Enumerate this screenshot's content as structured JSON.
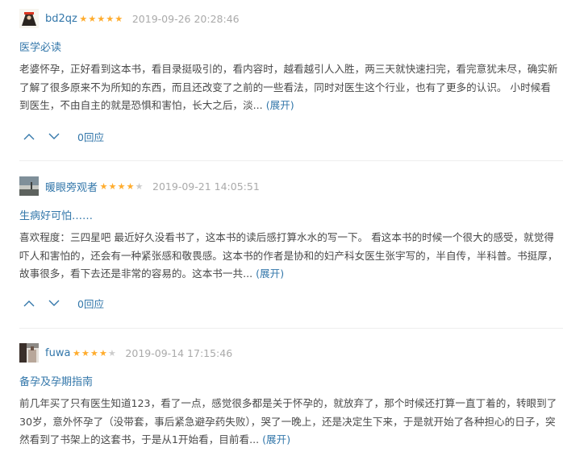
{
  "reviews": [
    {
      "avatar": "avatar-photo",
      "user": "bd2qz",
      "rating": 5,
      "date": "2019-09-26 20:28:46",
      "title": "医学必读",
      "text": "老婆怀孕，正好看到这本书，看目录挺吸引的，看内容时，越看越引人入胜，两三天就快速扫完，看完意犹未尽，确实新了解了很多原来不为所知的东西，而且还改变了之前的一些看法，同时对医生这个行业，也有了更多的认识。 小时候看到医生，不由自主的就是恐惧和害怕，长大之后，淡...",
      "expand": "(展开)",
      "replies": "0回应"
    },
    {
      "avatar": "avatar-photo",
      "user": "暖眼旁观者",
      "rating": 4,
      "date": "2019-09-21 14:05:51",
      "title": "生病好可怕……",
      "text": "喜欢程度：三四星吧 最近好久没看书了，这本书的读后感打算水水的写一下。 看这本书的时候一个很大的感受，就觉得吓人和害怕的，还会有一种紧张感和敬畏感。这本书的作者是协和的妇产科女医生张宇写的，半自传，半科普。书挺厚，故事很多，看下去还是非常的容易的。这本书一共...",
      "expand": "(展开)",
      "replies": "0回应"
    },
    {
      "avatar": "avatar-photo",
      "user": "fuwa",
      "rating": 4,
      "date": "2019-09-14 17:15:46",
      "title": "备孕及孕期指南",
      "text": "前几年买了只有医生知道123，看了一点，感觉很多都是关于怀孕的，就放弃了，那个时候还打算一直丁着的，转眼到了30岁，意外怀孕了（没带套，事后紧急避孕药失败），哭了一晚上，还是决定生下来，于是就开始了各种担心的日子，突然看到了书架上的这套书，于是从1开始看，目前看...",
      "expand": "(展开)",
      "replies": "0回应"
    }
  ],
  "colors": {
    "link": "#3377aa",
    "star": "#ffac2d",
    "date": "#aaaaaa",
    "text": "#494949"
  },
  "icons": {
    "up": "chevron-up-icon",
    "down": "chevron-down-icon",
    "star": "star-icon"
  }
}
